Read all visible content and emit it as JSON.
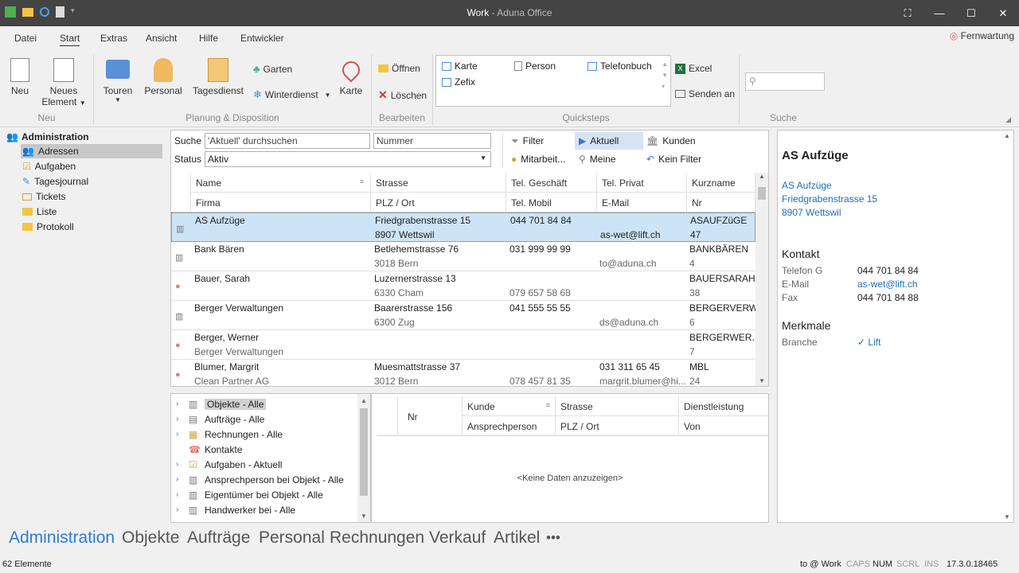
{
  "window": {
    "title": "Work",
    "app": " - Aduna Office"
  },
  "menu": {
    "tabs": [
      "Datei",
      "Start",
      "Extras",
      "Ansicht",
      "Hilfe",
      "Entwickler"
    ],
    "active": "Start",
    "fernwartung": "Fernwartung"
  },
  "ribbon": {
    "neu": "Neu",
    "neues_element": "Neues",
    "neues_element2": "Element",
    "group_neu": "Neu",
    "touren": "Touren",
    "personal": "Personal",
    "tagesdienst": "Tagesdienst",
    "garten": "Garten",
    "winterdienst": "Winterdienst",
    "karte": "Karte",
    "group_planung": "Planung & Disposition",
    "oeffnen": "Öffnen",
    "loeschen": "Löschen",
    "group_bearbeiten": "Bearbeiten",
    "qs_karte": "Karte",
    "qs_person": "Person",
    "qs_telefonbuch": "Telefonbuch",
    "qs_zefix": "Zefix",
    "group_quicksteps": "Quicksteps",
    "excel": "Excel",
    "senden_an": "Senden an",
    "group_suche": "Suche"
  },
  "nav": {
    "header": "Administration",
    "items": [
      "Adressen",
      "Aufgaben",
      "Tagesjournal",
      "Tickets",
      "Liste",
      "Protokoll"
    ]
  },
  "filter": {
    "suche_label": "Suche",
    "suche_value": "'Aktuell' durchsuchen",
    "nummer_value": "Nummer",
    "status_label": "Status",
    "status_value": "Aktiv",
    "filter": "Filter",
    "aktuell": "Aktuell",
    "kunden": "Kunden",
    "mitarbeit": "Mitarbeit...",
    "meine": "Meine",
    "kein_filter": "Kein Filter"
  },
  "grid": {
    "headers_top": [
      "Name",
      "Strasse",
      "Tel. Geschäft",
      "Tel. Privat",
      "Kurzname"
    ],
    "headers_bottom": [
      "Firma",
      "PLZ / Ort",
      "Tel. Mobil",
      "E-Mail",
      "Nr"
    ],
    "rows": [
      {
        "name": "AS Aufzüge",
        "firma": "",
        "strasse": "Friedgrabenstrasse 15",
        "ort": "8907 Wettswil",
        "telg": "044 701 84 84",
        "mobil": "",
        "telp": "",
        "email": "as-wet@lift.ch",
        "kurz": "ASAUFZüGE",
        "nr": "47",
        "type": "company"
      },
      {
        "name": "Bank Bären",
        "firma": "",
        "strasse": "Betlehemstrasse 76",
        "ort": "3018 Bern",
        "telg": "031 999 99 99",
        "mobil": "",
        "telp": "",
        "email": "to@aduna.ch",
        "kurz": "BANKBÄREN",
        "nr": "4",
        "type": "company"
      },
      {
        "name": "Bauer, Sarah",
        "firma": "",
        "strasse": "Luzernerstrasse 13",
        "ort": "6330 Cham",
        "telg": "",
        "mobil": "079 657 58 68",
        "telp": "",
        "email": "",
        "kurz": "BAUERSARAH",
        "nr": "38",
        "type": "person"
      },
      {
        "name": "Berger Verwaltungen",
        "firma": "",
        "strasse": "Baarerstrasse 156",
        "ort": "6300 Zug",
        "telg": "041 555 55 55",
        "mobil": "",
        "telp": "",
        "email": "ds@aduna.ch",
        "kurz": "BERGERVERW...",
        "nr": "6",
        "type": "company"
      },
      {
        "name": "Berger, Werner",
        "firma": "Berger Verwaltungen",
        "strasse": "",
        "ort": "",
        "telg": "",
        "mobil": "",
        "telp": "",
        "email": "",
        "kurz": "BERGERWER...",
        "nr": "7",
        "type": "person"
      },
      {
        "name": "Blumer, Margrit",
        "firma": "Clean Partner AG",
        "strasse": "Muesmattstrasse 37",
        "ort": "3012 Bern",
        "telg": "",
        "mobil": "078 457 81 35",
        "telp": "031 311 65 45",
        "email": "margrit.blumer@hi...",
        "kurz": "MBL",
        "nr": "24",
        "type": "person"
      }
    ]
  },
  "tree": {
    "items": [
      "Objekte - Alle",
      "Aufträge - Alle",
      "Rechnungen - Alle",
      "Kontakte",
      "Aufgaben - Aktuell",
      "Ansprechperson bei Objekt - Alle",
      "Eigentümer bei Objekt - Alle",
      "Handwerker bei - Alle"
    ]
  },
  "subgrid": {
    "nr": "Nr",
    "kunde": "Kunde",
    "strasse": "Strasse",
    "dienstleistung": "Dienstleistung",
    "ansprechperson": "Ansprechperson",
    "plz": "PLZ / Ort",
    "von": "Von",
    "empty": "<Keine Daten anzuzeigen>"
  },
  "detail": {
    "title": "AS Aufzüge",
    "addr1": "AS Aufzüge",
    "addr2": "Friedgrabenstrasse 15",
    "addr3": "8907 Wettswil",
    "kontakt": "Kontakt",
    "telefon_label": "Telefon G",
    "telefon_value": "044 701 84 84",
    "email_label": "E-Mail",
    "email_value": "as-wet@lift.ch",
    "fax_label": "Fax",
    "fax_value": "044 701 84 88",
    "merkmale": "Merkmale",
    "branche_label": "Branche",
    "branche_value": "✓ Lift"
  },
  "modules": [
    "Administration",
    "Objekte",
    "Aufträge",
    "Personal",
    "Rechnungen",
    "Verkauf",
    "Artikel",
    "•••"
  ],
  "status": {
    "count": "62 Elemente",
    "user": "to @ Work",
    "caps": "CAPS",
    "num": "NUM",
    "scrl": "SCRL",
    "ins": "INS",
    "version": "17.3.0.18465"
  },
  "colors": {
    "accent": "#2b7cd3",
    "titlebar": "#444444",
    "selection": "#cde4f7"
  }
}
